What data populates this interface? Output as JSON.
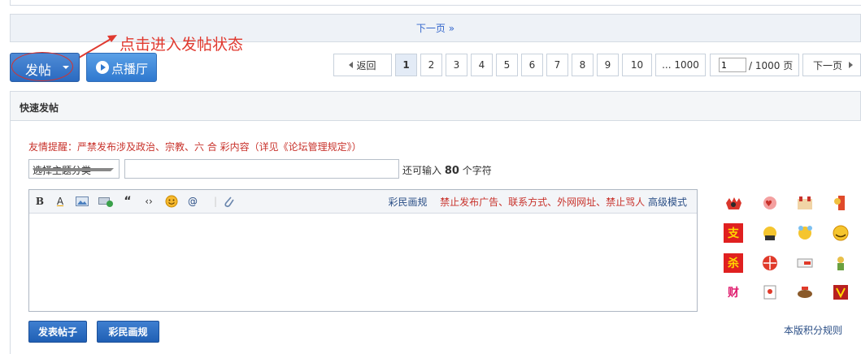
{
  "pager_top": {
    "next_label": "下一页 »"
  },
  "annotation": {
    "text": "点击进入发帖状态"
  },
  "buttons": {
    "post_label": "发帖",
    "live_label": "点播厅"
  },
  "pagination": {
    "back_label": "返回",
    "pages": [
      "1",
      "2",
      "3",
      "4",
      "5",
      "6",
      "7",
      "8",
      "9",
      "10",
      "... 1000"
    ],
    "current": "1",
    "input_value": "1",
    "total_label": "/ 1000 页",
    "next_label": "下一页"
  },
  "quick_post": {
    "heading": "快速发帖",
    "notice": "友情提醒：严禁发布涉及政治、宗教、六 合 彩内容（详见《论坛管理规定》）",
    "category_placeholder": "选择主题分类",
    "remain_prefix": "还可输入",
    "remain_count": "80",
    "remain_suffix": "个字符",
    "toolbar_links": {
      "rules": "彩民画规",
      "warning": "禁止发布广告、联系方式、外网网址、禁止骂人",
      "advanced": "高级模式"
    },
    "submit_label": "发表帖子",
    "rules_button_label": "彩民画规",
    "points_rules_link": "本版积分规则"
  },
  "toolbar_icons": [
    "bold-icon",
    "font-color-icon",
    "image-icon",
    "attach-media-icon",
    "quote-icon",
    "code-icon",
    "smiley-icon",
    "at-icon",
    "paperclip-icon"
  ],
  "smilies": [
    "smiley-1",
    "smiley-2",
    "smiley-3",
    "smiley-4",
    "smiley-zhi",
    "smiley-6",
    "smiley-7",
    "smiley-8",
    "smiley-sha",
    "smiley-10",
    "smiley-11",
    "smiley-12",
    "smiley-cai",
    "smiley-14",
    "smiley-15",
    "smiley-16"
  ],
  "colors": {
    "accent_blue": "#2a6ac0",
    "warning_red": "#c8322b",
    "link_blue": "#2a4e86"
  }
}
